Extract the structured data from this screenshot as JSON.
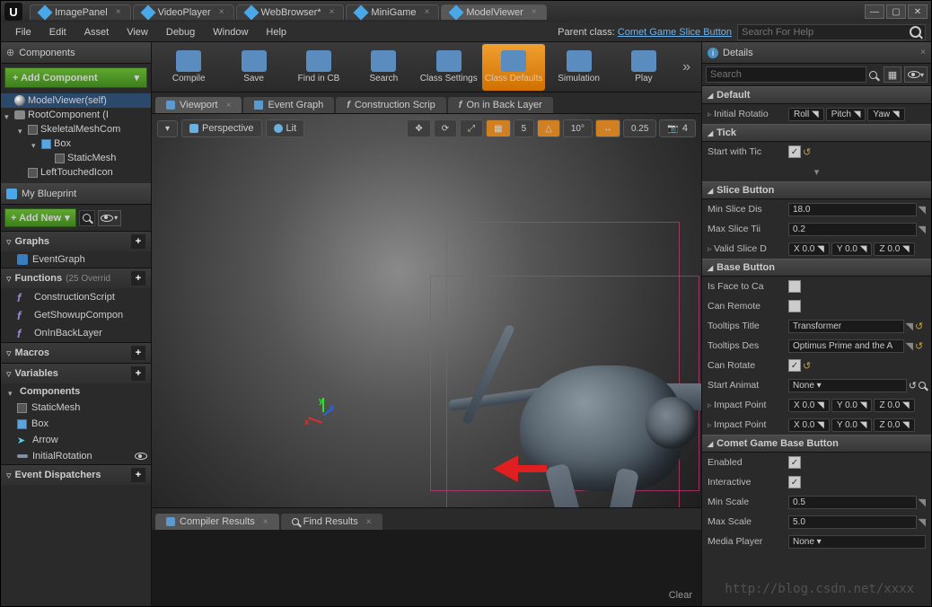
{
  "titlebar": {
    "tabs": [
      {
        "label": "ImagePanel"
      },
      {
        "label": "VideoPlayer"
      },
      {
        "label": "WebBrowser*"
      },
      {
        "label": "MiniGame"
      },
      {
        "label": "ModelViewer"
      }
    ]
  },
  "menubar": {
    "items": [
      "File",
      "Edit",
      "Asset",
      "View",
      "Debug",
      "Window",
      "Help"
    ],
    "parent_class_label": "Parent class:",
    "parent_class": "Comet Game Slice Button",
    "help_placeholder": "Search For Help"
  },
  "toolbar": {
    "buttons": [
      {
        "label": "Compile"
      },
      {
        "label": "Save"
      },
      {
        "label": "Find in CB"
      },
      {
        "label": "Search"
      },
      {
        "label": "Class Settings"
      },
      {
        "label": "Class Defaults"
      },
      {
        "label": "Simulation"
      },
      {
        "label": "Play"
      }
    ],
    "active_index": 5
  },
  "components_panel": {
    "title": "Components",
    "add_label": "+ Add Component",
    "tree": [
      {
        "label": "ModelViewer(self)",
        "indent": 0,
        "icon": "sphere",
        "sel": true
      },
      {
        "label": "RootComponent (I",
        "indent": 0,
        "icon": "camera",
        "caret": true
      },
      {
        "label": "SkeletalMeshCom",
        "indent": 1,
        "icon": "mesh",
        "caret": true
      },
      {
        "label": "Box",
        "indent": 2,
        "icon": "box",
        "caret": true
      },
      {
        "label": "StaticMesh",
        "indent": 3,
        "icon": "mesh"
      },
      {
        "label": "LeftTouchedIcon",
        "indent": 1,
        "icon": "mesh"
      }
    ]
  },
  "myblueprint": {
    "title": "My Blueprint",
    "add_new": "+ Add New",
    "sections": {
      "graphs": {
        "title": "Graphs",
        "items": [
          "EventGraph"
        ]
      },
      "functions": {
        "title": "Functions",
        "note": "(25 Overrid",
        "items": [
          "ConstructionScript",
          "GetShowupCompon",
          "OnInBackLayer"
        ]
      },
      "macros": {
        "title": "Macros",
        "items": []
      },
      "variables": {
        "title": "Variables",
        "subhead": "Components",
        "items": [
          "StaticMesh",
          "Box",
          "Arrow",
          "InitialRotation"
        ]
      },
      "dispatchers": {
        "title": "Event Dispatchers",
        "items": []
      }
    }
  },
  "center": {
    "subtabs": [
      "Viewport",
      "Event Graph",
      "Construction Scrip",
      "On in Back Layer"
    ],
    "viewport": {
      "perspective": "Perspective",
      "lit": "Lit",
      "snap_vals": [
        "5",
        "10°",
        "0.25",
        "4"
      ]
    },
    "bottom_tabs": [
      "Compiler Results",
      "Find Results"
    ],
    "clear": "Clear"
  },
  "details": {
    "title": "Details",
    "search_placeholder": "Search",
    "cats": [
      {
        "name": "Default",
        "rows": [
          {
            "label": "Initial Rotatio",
            "type": "rot",
            "vals": [
              "Roll",
              "Pitch",
              "Yaw"
            ],
            "caret": true
          }
        ]
      },
      {
        "name": "Tick",
        "rows": [
          {
            "label": "Start with Tic",
            "type": "check",
            "val": true,
            "reset": true
          }
        ]
      },
      {
        "name": "Slice Button",
        "rows": [
          {
            "label": "Min Slice Dis",
            "type": "num",
            "val": "18.0"
          },
          {
            "label": "Max Slice Tii",
            "type": "num",
            "val": "0.2"
          },
          {
            "label": "Valid Slice D",
            "type": "vec",
            "vals": [
              "X  0.0",
              "Y  0.0",
              "Z  0.0"
            ],
            "caret": true
          }
        ]
      },
      {
        "name": "Base Button",
        "rows": [
          {
            "label": "Is Face to Ca",
            "type": "check",
            "val": false
          },
          {
            "label": "Can Remote",
            "type": "check",
            "val": false
          },
          {
            "label": "Tooltips Title",
            "type": "text",
            "val": "Transformer",
            "reset": true
          },
          {
            "label": "Tooltips Des",
            "type": "text",
            "val": "Optimus Prime and the A",
            "reset": true
          },
          {
            "label": "Can Rotate",
            "type": "check",
            "val": true,
            "reset": true
          },
          {
            "label": "Start Animat",
            "type": "combo",
            "val": "None",
            "extra": "reset-search"
          },
          {
            "label": "Impact Point",
            "type": "vec",
            "vals": [
              "X  0.0",
              "Y  0.0",
              "Z  0.0"
            ],
            "caret": true
          },
          {
            "label": "Impact Point",
            "type": "vec",
            "vals": [
              "X  0.0",
              "Y  0.0",
              "Z  0.0"
            ],
            "caret": true
          }
        ]
      },
      {
        "name": "Comet Game Base Button",
        "rows": [
          {
            "label": "Enabled",
            "type": "check",
            "val": true
          },
          {
            "label": "Interactive",
            "type": "check",
            "val": true
          },
          {
            "label": "Min Scale",
            "type": "num",
            "val": "0.5"
          },
          {
            "label": "Max Scale",
            "type": "num",
            "val": "5.0"
          },
          {
            "label": "Media Player",
            "type": "combo",
            "val": "None"
          }
        ]
      }
    ]
  },
  "watermark": "http://blog.csdn.net/xxxx"
}
